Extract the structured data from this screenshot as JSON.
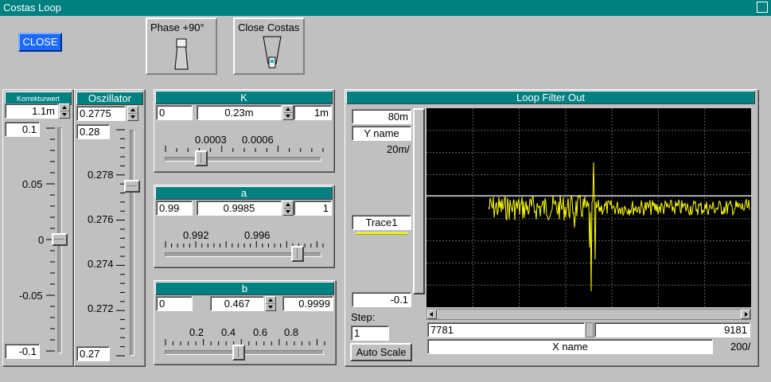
{
  "window": {
    "title": "Costas Loop"
  },
  "close_button": {
    "label": "CLOSE",
    "color": "#1a6aff"
  },
  "phase_switch": {
    "label": "Phase +90°"
  },
  "close_costas_switch": {
    "label": "Close Costas"
  },
  "korrektur": {
    "title": "Korrekturwert",
    "value": "1.1m",
    "max": "0.1",
    "min": "-0.1",
    "ticks": [
      "0.05",
      "0",
      "-0.05"
    ],
    "level": 0.5
  },
  "oszillator": {
    "title": "Oszillator",
    "value": "0.2775",
    "max": "0.28",
    "min": "0.27",
    "ticks": [
      "0.278",
      "0.276",
      "0.274",
      "0.272"
    ],
    "level": 0.75
  },
  "k_panel": {
    "title": "K",
    "min": "0",
    "value": "0.23m",
    "max": "1m",
    "ticks": [
      "0.0003",
      "0.0006"
    ],
    "level": 0.23
  },
  "a_panel": {
    "title": "a",
    "min": "0.99",
    "value": "0.9985",
    "max": "1",
    "ticks": [
      "0.992",
      "0.996"
    ],
    "level": 0.85
  },
  "b_panel": {
    "title": "b",
    "min": "0",
    "value": "0.467",
    "max": "0.9999",
    "ticks": [
      "0.2",
      "0.4",
      "0.6",
      "0.8"
    ],
    "level": 0.467
  },
  "graph": {
    "title": "Loop Filter Out",
    "y_max": "80m",
    "y_name": "Y name",
    "y_div": "20m/",
    "trace": "Trace1",
    "trace_color": "#ffff00",
    "y_min": "-0.1",
    "step_label": "Step:",
    "step_value": "1",
    "auto_scale": "Auto Scale",
    "x_min": "7781",
    "x_max": "9181",
    "x_name": "X name",
    "x_div": "200/"
  },
  "chart_data": {
    "type": "line",
    "title": "Loop Filter Out",
    "xlabel": "X name",
    "ylabel": "Y name",
    "xlim": [
      7781,
      9181
    ],
    "ylim": [
      -0.1,
      0.08
    ],
    "series": [
      {
        "name": "Trace1",
        "note": "noisy signal around 0.0 starting near x=8050, spike to about 0.04 and -0.07 near x=8520"
      }
    ]
  }
}
